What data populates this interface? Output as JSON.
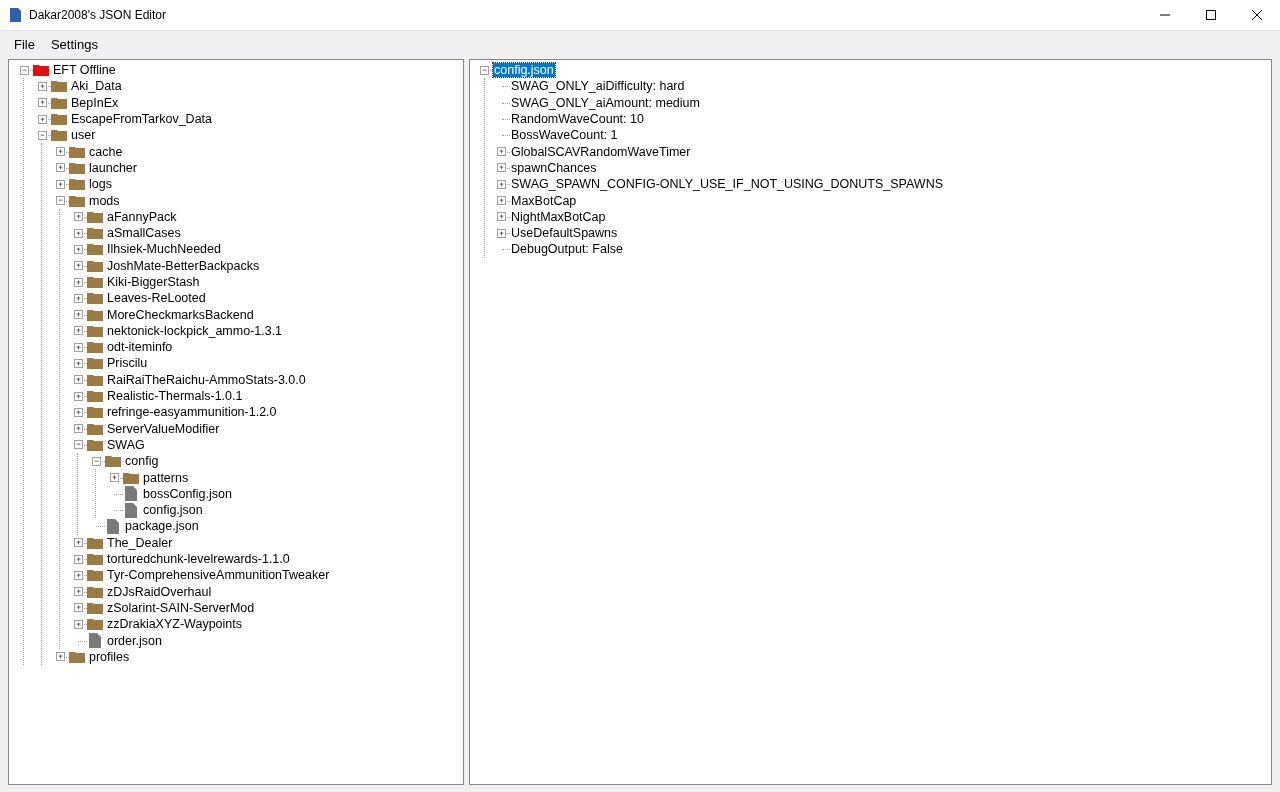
{
  "window": {
    "title": "Dakar2008's JSON Editor"
  },
  "menu": [
    "File",
    "Settings"
  ],
  "folder_tree": {
    "label": "EFT Offline",
    "kind": "drive",
    "expanded": true,
    "selected": false,
    "children": [
      {
        "label": "Aki_Data",
        "kind": "folder",
        "expanded": false,
        "selected": false
      },
      {
        "label": "BepInEx",
        "kind": "folder",
        "expanded": false,
        "selected": false
      },
      {
        "label": "EscapeFromTarkov_Data",
        "kind": "folder",
        "expanded": false,
        "selected": false
      },
      {
        "label": "user",
        "kind": "folder",
        "expanded": true,
        "selected": false,
        "children": [
          {
            "label": "cache",
            "kind": "folder",
            "expanded": false,
            "selected": false
          },
          {
            "label": "launcher",
            "kind": "folder",
            "expanded": false,
            "selected": false
          },
          {
            "label": "logs",
            "kind": "folder",
            "expanded": false,
            "selected": false
          },
          {
            "label": "mods",
            "kind": "folder",
            "expanded": true,
            "selected": false,
            "children": [
              {
                "label": "aFannyPack",
                "kind": "folder",
                "expanded": false,
                "selected": false
              },
              {
                "label": "aSmallCases",
                "kind": "folder",
                "expanded": false,
                "selected": false
              },
              {
                "label": "Ilhsiek-MuchNeeded",
                "kind": "folder",
                "expanded": false,
                "selected": false
              },
              {
                "label": "JoshMate-BetterBackpacks",
                "kind": "folder",
                "expanded": false,
                "selected": false
              },
              {
                "label": "Kiki-BiggerStash",
                "kind": "folder",
                "expanded": false,
                "selected": false
              },
              {
                "label": "Leaves-ReLooted",
                "kind": "folder",
                "expanded": false,
                "selected": false
              },
              {
                "label": "MoreCheckmarksBackend",
                "kind": "folder",
                "expanded": false,
                "selected": false
              },
              {
                "label": "nektonick-lockpick_ammo-1.3.1",
                "kind": "folder",
                "expanded": false,
                "selected": false
              },
              {
                "label": "odt-iteminfo",
                "kind": "folder",
                "expanded": false,
                "selected": false
              },
              {
                "label": "Priscilu",
                "kind": "folder",
                "expanded": false,
                "selected": false
              },
              {
                "label": "RaiRaiTheRaichu-AmmoStats-3.0.0",
                "kind": "folder",
                "expanded": false,
                "selected": false
              },
              {
                "label": "Realistic-Thermals-1.0.1",
                "kind": "folder",
                "expanded": false,
                "selected": false
              },
              {
                "label": "refringe-easyammunition-1.2.0",
                "kind": "folder",
                "expanded": false,
                "selected": false
              },
              {
                "label": "ServerValueModifier",
                "kind": "folder",
                "expanded": false,
                "selected": false
              },
              {
                "label": "SWAG",
                "kind": "folder",
                "expanded": true,
                "selected": false,
                "children": [
                  {
                    "label": "config",
                    "kind": "folder",
                    "expanded": true,
                    "selected": false,
                    "children": [
                      {
                        "label": "patterns",
                        "kind": "folder",
                        "expanded": false,
                        "selected": false
                      },
                      {
                        "label": "bossConfig.json",
                        "kind": "file",
                        "selected": false
                      },
                      {
                        "label": "config.json",
                        "kind": "file",
                        "selected": false
                      }
                    ]
                  },
                  {
                    "label": "package.json",
                    "kind": "file",
                    "selected": false
                  }
                ]
              },
              {
                "label": "The_Dealer",
                "kind": "folder",
                "expanded": false,
                "selected": false
              },
              {
                "label": "torturedchunk-levelrewards-1.1.0",
                "kind": "folder",
                "expanded": false,
                "selected": false
              },
              {
                "label": "Tyr-ComprehensiveAmmunitionTweaker",
                "kind": "folder",
                "expanded": false,
                "selected": false
              },
              {
                "label": "zDJsRaidOverhaul",
                "kind": "folder",
                "expanded": false,
                "selected": false
              },
              {
                "label": "zSolarint-SAIN-ServerMod",
                "kind": "folder",
                "expanded": false,
                "selected": false
              },
              {
                "label": "zzDrakiaXYZ-Waypoints",
                "kind": "folder",
                "expanded": false,
                "selected": false
              },
              {
                "label": "order.json",
                "kind": "file",
                "selected": false
              }
            ]
          },
          {
            "label": "profiles",
            "kind": "folder",
            "expanded": false,
            "selected": false
          }
        ]
      }
    ]
  },
  "config_tree": {
    "label": "config.json",
    "expanded": true,
    "selected": true,
    "children": [
      {
        "label": "SWAG_ONLY_aiDifficulty: hard",
        "selected": false
      },
      {
        "label": "SWAG_ONLY_aiAmount: medium",
        "selected": false
      },
      {
        "label": "RandomWaveCount: 10",
        "selected": false
      },
      {
        "label": "BossWaveCount: 1",
        "selected": false
      },
      {
        "label": "GlobalSCAVRandomWaveTimer",
        "expanded": false,
        "selected": false
      },
      {
        "label": "spawnChances",
        "expanded": false,
        "selected": false
      },
      {
        "label": "SWAG_SPAWN_CONFIG-ONLY_USE_IF_NOT_USING_DONUTS_SPAWNS",
        "expanded": false,
        "selected": false
      },
      {
        "label": "MaxBotCap",
        "expanded": false,
        "selected": false
      },
      {
        "label": "NightMaxBotCap",
        "expanded": false,
        "selected": false
      },
      {
        "label": "UseDefaultSpawns",
        "expanded": false,
        "selected": false
      },
      {
        "label": "DebugOutput: False",
        "selected": false
      }
    ]
  }
}
